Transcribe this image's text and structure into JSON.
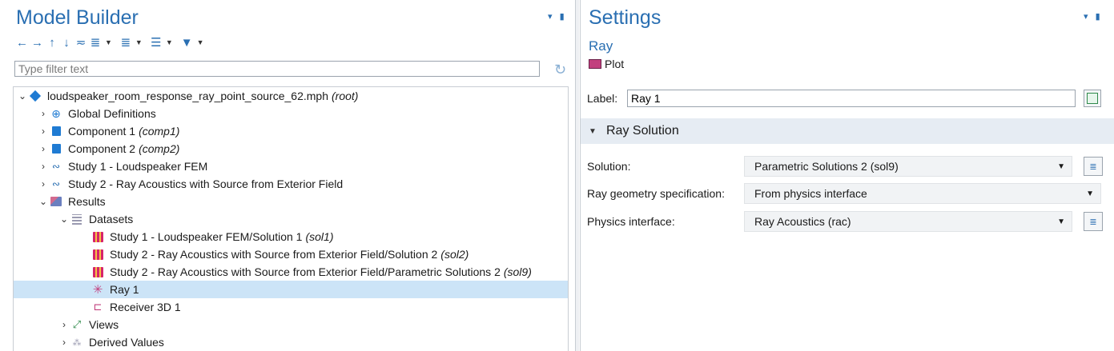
{
  "model_builder": {
    "title": "Model Builder",
    "toolbar": [
      "back-arrow",
      "forward-arrow",
      "move-up-arrow",
      "move-down-arrow",
      "show-icon",
      "expand-icon",
      "collapse-icon",
      "view-icon",
      "filter-icon"
    ],
    "filter_placeholder": "Type filter text",
    "tree": [
      {
        "chevron": "⌄",
        "icon": "diamond",
        "label": "loudspeaker_room_response_ray_point_source_62.mph",
        "tag": "(root)"
      },
      {
        "chevron": "›",
        "icon": "globe",
        "label": "Global Definitions",
        "tag": ""
      },
      {
        "chevron": "›",
        "icon": "cube",
        "label": "Component 1",
        "tag": "(comp1)"
      },
      {
        "chevron": "›",
        "icon": "cube",
        "label": "Component 2",
        "tag": "(comp2)"
      },
      {
        "chevron": "›",
        "icon": "study",
        "label": "Study 1 - Loudspeaker FEM",
        "tag": ""
      },
      {
        "chevron": "›",
        "icon": "study",
        "label": "Study 2 - Ray Acoustics with Source from Exterior Field",
        "tag": ""
      },
      {
        "chevron": "⌄",
        "icon": "results",
        "label": "Results",
        "tag": ""
      },
      {
        "chevron": "⌄",
        "icon": "datasets",
        "label": "Datasets",
        "tag": ""
      },
      {
        "chevron": "",
        "icon": "solution",
        "label": "Study 1 - Loudspeaker FEM/Solution 1",
        "tag": "(sol1)"
      },
      {
        "chevron": "",
        "icon": "solution",
        "label": "Study 2 - Ray Acoustics with Source from Exterior Field/Solution 2",
        "tag": "(sol2)"
      },
      {
        "chevron": "",
        "icon": "solution",
        "label": "Study 2 - Ray Acoustics with Source from Exterior Field/Parametric Solutions 2",
        "tag": "(sol9)"
      },
      {
        "chevron": "",
        "icon": "ray",
        "label": "Ray 1",
        "tag": ""
      },
      {
        "chevron": "",
        "icon": "receiver",
        "label": "Receiver 3D 1",
        "tag": ""
      },
      {
        "chevron": "›",
        "icon": "views",
        "label": "Views",
        "tag": ""
      },
      {
        "chevron": "›",
        "icon": "derived",
        "label": "Derived Values",
        "tag": ""
      }
    ]
  },
  "settings": {
    "title": "Settings",
    "subtitle": "Ray",
    "node_type": "Plot",
    "label_caption": "Label:",
    "label_value": "Ray 1",
    "section": {
      "title": "Ray Solution",
      "rows": [
        {
          "label": "Solution:",
          "value": "Parametric Solutions 2 (sol9)"
        },
        {
          "label": "Ray geometry specification:",
          "value": "From physics interface"
        },
        {
          "label": "Physics interface:",
          "value": "Ray Acoustics (rac)"
        }
      ]
    }
  },
  "colors": {
    "accent": "#2a6fb2",
    "selection": "#cce4f7",
    "section_bg": "#e6ecf3"
  }
}
